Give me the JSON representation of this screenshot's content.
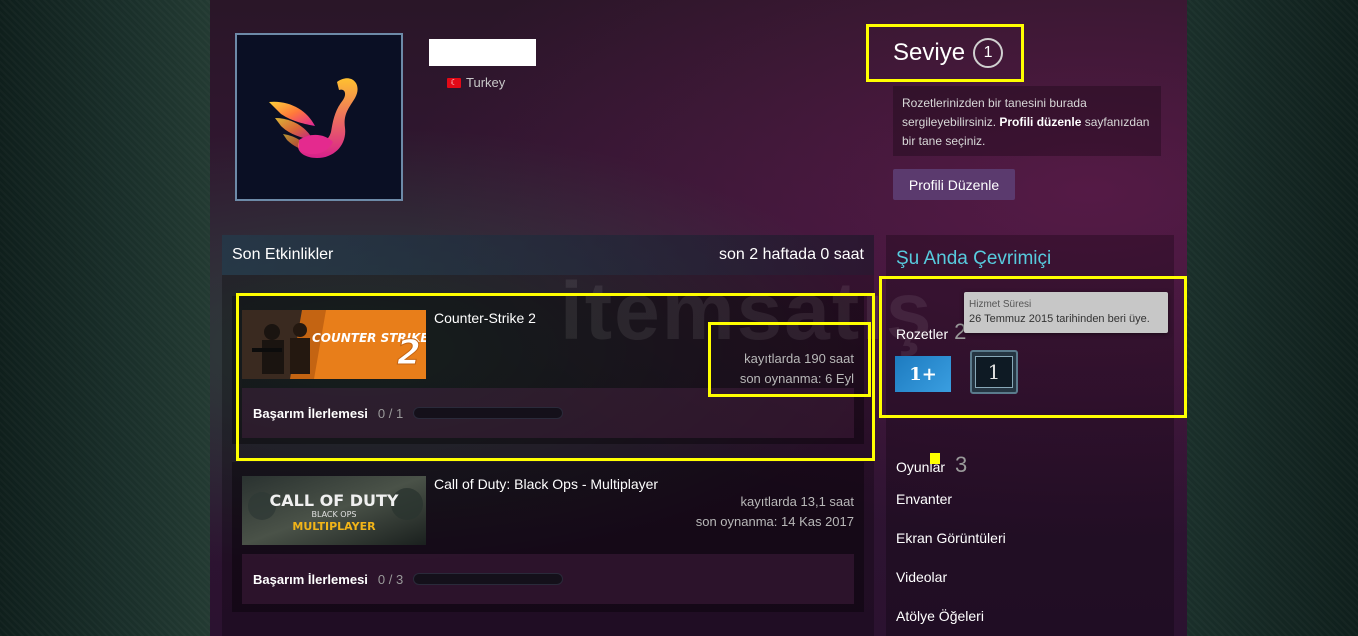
{
  "profile": {
    "country": "Turkey"
  },
  "level": {
    "label": "Seviye",
    "value": "1"
  },
  "badge_info": {
    "text_before": "Rozetlerinizden bir tanesini burada sergileyebilirsiniz.",
    "link": "Profili düzenle",
    "text_after": "sayfanızdan bir tane seçiniz."
  },
  "edit_profile_button": "Profili Düzenle",
  "activity": {
    "title": "Son Etkinlikler",
    "summary": "son 2 haftada 0 saat",
    "games": [
      {
        "title": "Counter-Strike 2",
        "capsule_text": "COUNTER STRIKE",
        "playtime": "kayıtlarda 190 saat",
        "last_played": "son oynanma: 6 Eyl",
        "achievement_label": "Başarım İlerlemesi",
        "achievement_count": "0 / 1",
        "achievement_progress": 0
      },
      {
        "title": "Call of Duty: Black Ops - Multiplayer",
        "capsule_text": "CALL OF DUTY",
        "capsule_sub": "BLACK OPS",
        "capsule_mode": "MULTIPLAYER",
        "playtime": "kayıtlarda 13,1 saat",
        "last_played": "son oynanma: 14 Kas 2017",
        "achievement_label": "Başarım İlerlemesi",
        "achievement_count": "0 / 3",
        "achievement_progress": 0
      }
    ]
  },
  "sidebar": {
    "online_status": "Şu Anda Çevrimiçi",
    "badges_label": "Rozetler",
    "badges_count": "2",
    "tooltip_title": "Hizmet Süresi",
    "tooltip_text": "26 Temmuz 2015 tarihinden beri üye.",
    "badge_years_text": "1+",
    "badge_level_text": "1",
    "games_label": "Oyunlar",
    "games_count": "3",
    "links": [
      "Envanter",
      "Ekran Görüntüleri",
      "Videolar",
      "Atölye Öğeleri"
    ]
  },
  "watermark": "itemsatış",
  "colors": {
    "highlight": "#ffff00",
    "online": "#57cbde",
    "button": "#5b3a6e"
  }
}
